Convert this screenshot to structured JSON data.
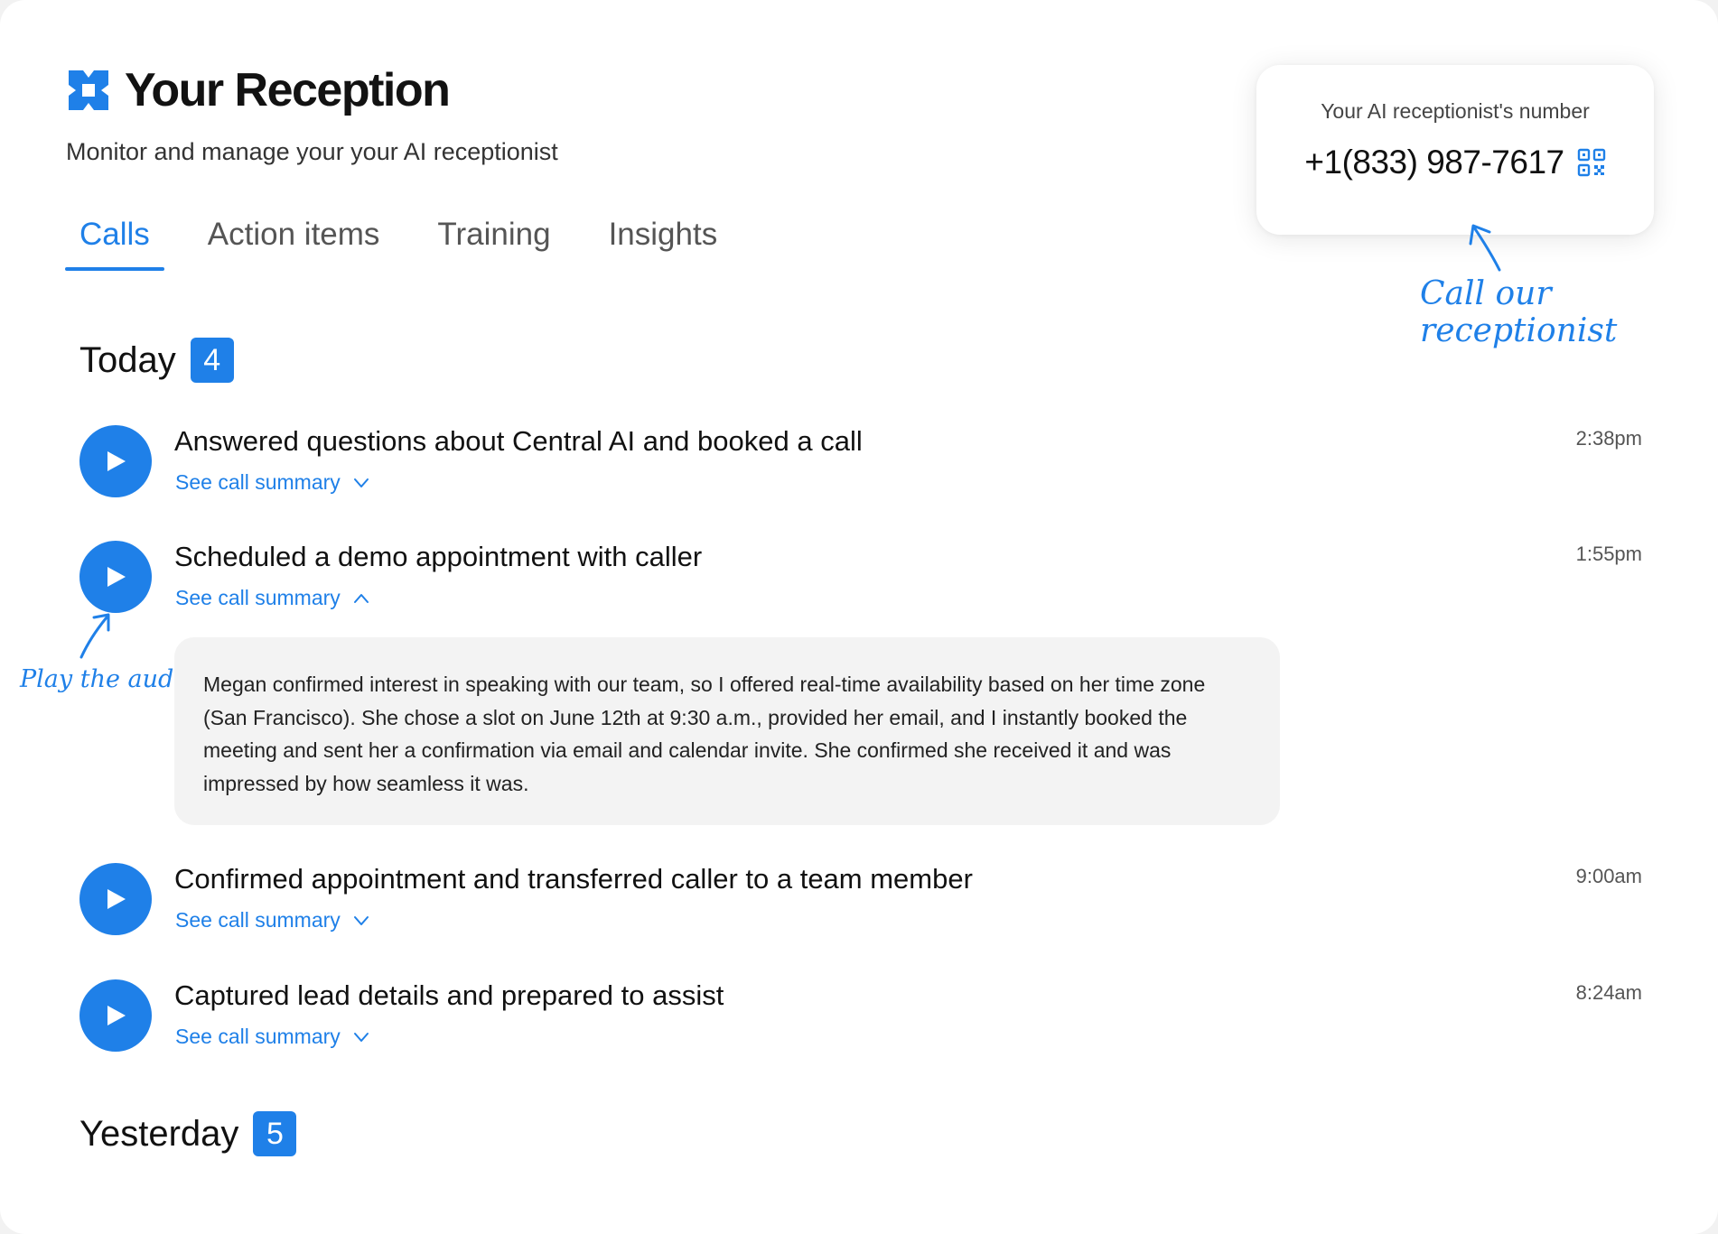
{
  "header": {
    "title": "Your Reception",
    "subtitle": "Monitor and manage your your AI receptionist"
  },
  "tabs": [
    {
      "label": "Calls",
      "active": true
    },
    {
      "label": "Action items",
      "active": false
    },
    {
      "label": "Training",
      "active": false
    },
    {
      "label": "Insights",
      "active": false
    }
  ],
  "number_card": {
    "label": "Your AI receptionist's number",
    "number": "+1(833) 987-7617",
    "icon": "qr-code-icon"
  },
  "annotations": {
    "call": "Call our receptionist",
    "play": "Play the audio"
  },
  "sections": [
    {
      "title": "Today",
      "count": "4",
      "calls": [
        {
          "title": "Answered questions about Central AI and booked a call",
          "link": "See call summary",
          "time": "2:38pm",
          "expanded": false
        },
        {
          "title": "Scheduled a demo appointment with caller",
          "link": "See call summary",
          "time": "1:55pm",
          "expanded": true,
          "summary": "Megan confirmed interest in speaking with our team, so I offered real-time availability based on her time zone (San Francisco). She chose a slot on June 12th at 9:30 a.m., provided her email, and I instantly booked the meeting and sent her a confirmation via email and calendar invite. She confirmed she received it and was impressed by how seamless it was."
        },
        {
          "title": "Confirmed appointment and transferred caller to a team member",
          "link": "See call summary",
          "time": "9:00am",
          "expanded": false
        },
        {
          "title": "Captured lead details and prepared to assist",
          "link": "See call summary",
          "time": "8:24am",
          "expanded": false
        }
      ]
    },
    {
      "title": "Yesterday",
      "count": "5",
      "calls": []
    }
  ],
  "colors": {
    "accent": "#1f80e8",
    "summary_bg": "#f3f3f3"
  }
}
